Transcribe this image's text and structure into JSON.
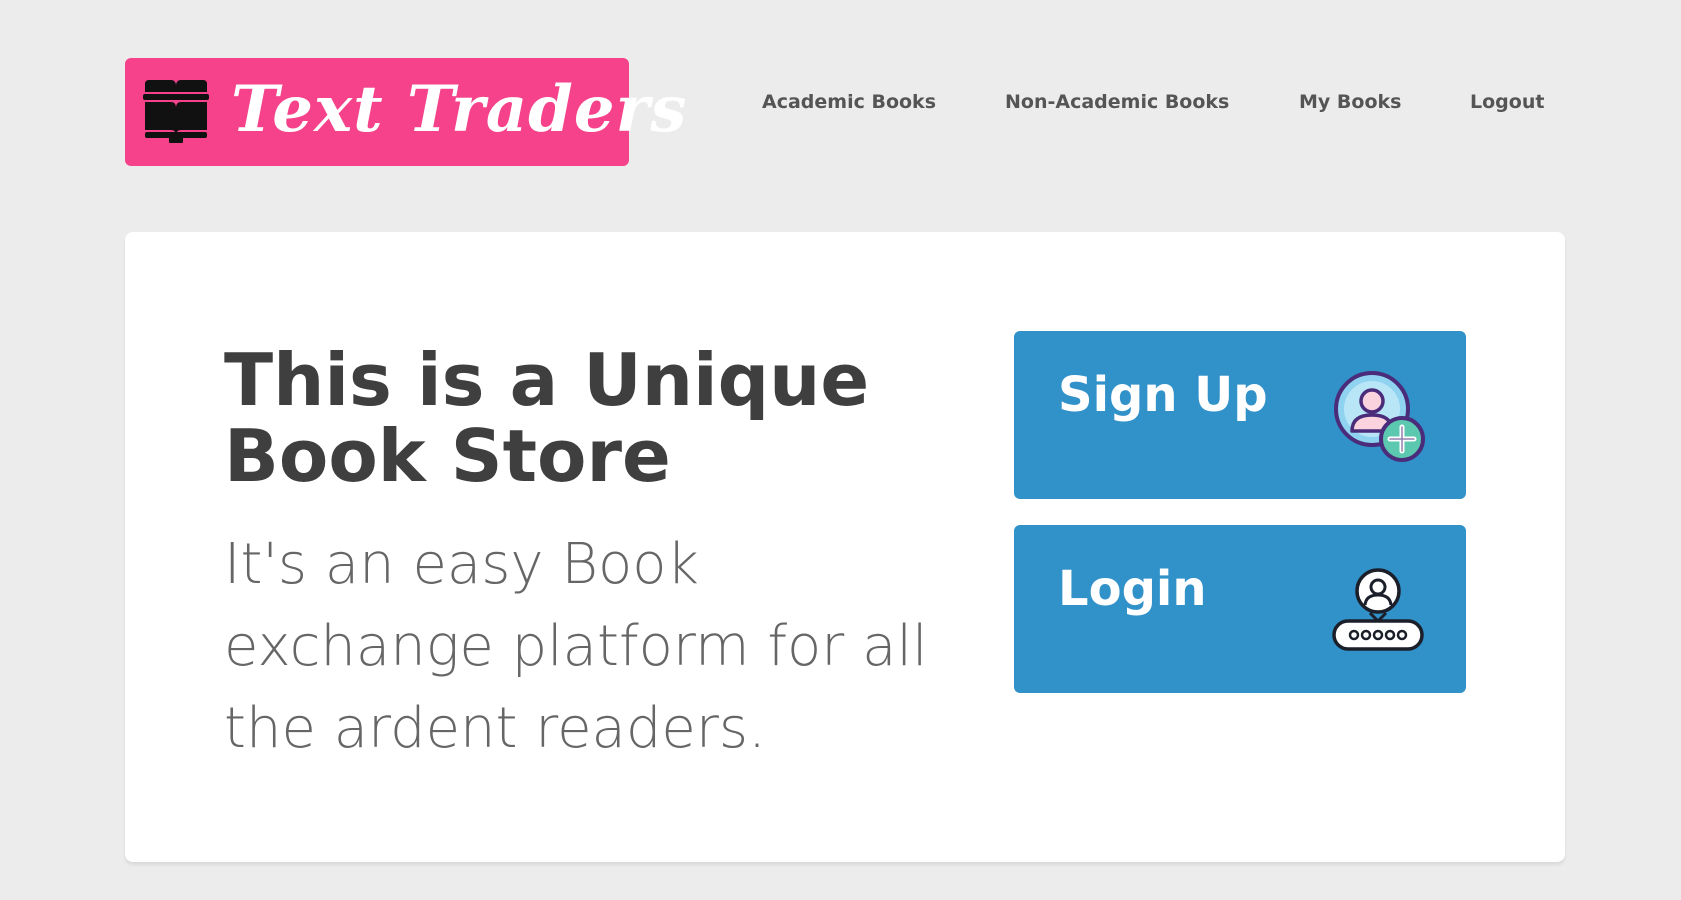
{
  "header": {
    "logo": {
      "text": "Text Traders",
      "icon": "book-icon",
      "color": "#f6428a"
    },
    "nav": [
      {
        "label": "Academic Books"
      },
      {
        "label": "Non-Academic Books"
      },
      {
        "label": "My Books"
      },
      {
        "label": "Logout"
      }
    ]
  },
  "hero": {
    "headline": "This is a Unique Book Store",
    "subtext": "It's an easy Book exchange platform for all the ardent readers."
  },
  "actions": {
    "signup": {
      "label": "Sign Up",
      "icon": "add-user-icon"
    },
    "login": {
      "label": "Login",
      "icon": "user-password-icon"
    },
    "color": "#3191c9"
  }
}
